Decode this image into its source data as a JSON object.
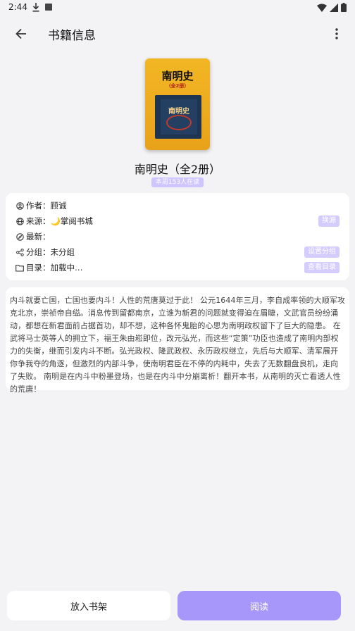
{
  "status_bar": {
    "time": "2:44"
  },
  "app_bar": {
    "title": "书籍信息"
  },
  "book": {
    "cover_title": "南明史",
    "cover_subtitle": "（全2册）",
    "name": "南明史（全2册）",
    "reading_badge": "本周153人在读"
  },
  "info": {
    "author": {
      "label": "作者：",
      "value": "顾诚"
    },
    "source": {
      "label": "来源：",
      "value": "🌙掌阅书城",
      "action": "换源"
    },
    "latest": {
      "label": "最新：",
      "value": ""
    },
    "group": {
      "label": "分组：",
      "value": "未分组",
      "action": "设置分组"
    },
    "toc": {
      "label": "目录：",
      "value": "加载中…",
      "action": "查看目录"
    }
  },
  "intro": "内斗就要亡国，亡国也要内斗！人性的荒唐莫过于此！ 公元1644年三月，李自成率领的大顺军攻克北京，崇祯帝自缢。消息传到留都南京，立谁为新君的问题就变得迫在眉睫，文武官员纷纷涌动，都想在新君面前占据首功，却不想，这种各怀鬼胎的心思为南明政权留下了巨大的隐患。 在武将马士英等人的拥立下，福王朱由崧即位，改元弘光，而这些“定策”功臣也造成了南明内部权力的失衡，继而引发内斗不断。弘光政权、隆武政权、永历政权继立，先后与大顺军、清军展开你争我夺的角逐，但激烈的内部斗争，使南明君臣在不停的内耗中，失去了无数翻盘良机，走向了失败。 南明是在内斗中粉墨登场，也是在内斗中分崩离析！翻开本书，从南明的灭亡看透人性的荒唐！",
  "actions": {
    "add_shelf": "放入书架",
    "read": "阅读"
  },
  "colors": {
    "accent": "#a797fb",
    "tag": "#d4ccff",
    "background": "#f3f3f5"
  }
}
